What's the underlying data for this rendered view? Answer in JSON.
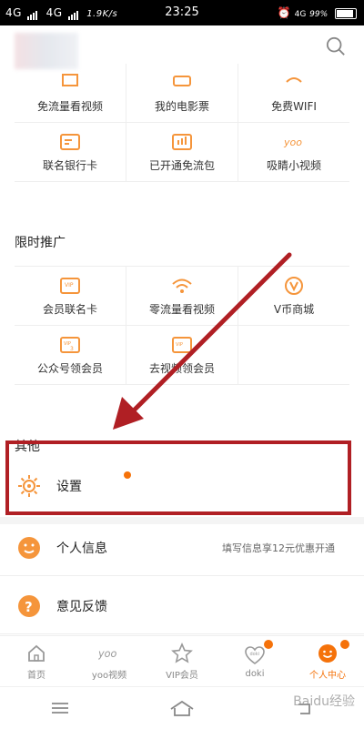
{
  "status": {
    "carrier1": "4G",
    "carrier2": "4G",
    "speed": "1.9K/s",
    "time": "23:25",
    "net": "4G",
    "battery": "99%"
  },
  "colors": {
    "accent": "#f5720a",
    "annotation": "#b01f24",
    "icon_orange": "#f5953b"
  },
  "grid1": {
    "rows": [
      [
        {
          "label": "免流量看视频",
          "icon": "video-icon"
        },
        {
          "label": "我的电影票",
          "icon": "ticket-icon"
        },
        {
          "label": "免费WIFI",
          "icon": "wifi-icon"
        }
      ],
      [
        {
          "label": "联名银行卡",
          "icon": "card-icon"
        },
        {
          "label": "已开通免流包",
          "icon": "data-package-icon"
        },
        {
          "label": "吸睛小视频",
          "icon": "yoo-icon"
        }
      ]
    ]
  },
  "promo": {
    "title": "限时推广",
    "rows": [
      [
        {
          "label": "会员联名卡",
          "icon": "vip-card-icon"
        },
        {
          "label": "零流量看视频",
          "icon": "wifi-icon"
        },
        {
          "label": "V币商城",
          "icon": "vcoin-icon"
        }
      ],
      [
        {
          "label": "公众号领会员",
          "icon": "vip-3-icon"
        },
        {
          "label": "去视频领会员",
          "icon": "vip-gift-icon"
        },
        {
          "label": "",
          "icon": ""
        }
      ]
    ]
  },
  "other": {
    "title": "其他",
    "items": [
      {
        "label": "设置",
        "icon": "gear-icon",
        "right": ""
      },
      {
        "label": "个人信息",
        "icon": "profile-icon",
        "right": "填写信息享12元优惠开通"
      },
      {
        "label": "意见反馈",
        "icon": "feedback-icon",
        "right": ""
      }
    ]
  },
  "tabs": [
    {
      "label": "首页",
      "icon": "home-icon",
      "active": false
    },
    {
      "label": "yoo视频",
      "icon": "yoo-icon",
      "active": false
    },
    {
      "label": "VIP会员",
      "icon": "vip-star-icon",
      "active": false
    },
    {
      "label": "doki",
      "icon": "doki-icon",
      "active": false
    },
    {
      "label": "个人中心",
      "icon": "smiley-icon",
      "active": true
    }
  ],
  "watermark": "Baidu经验"
}
